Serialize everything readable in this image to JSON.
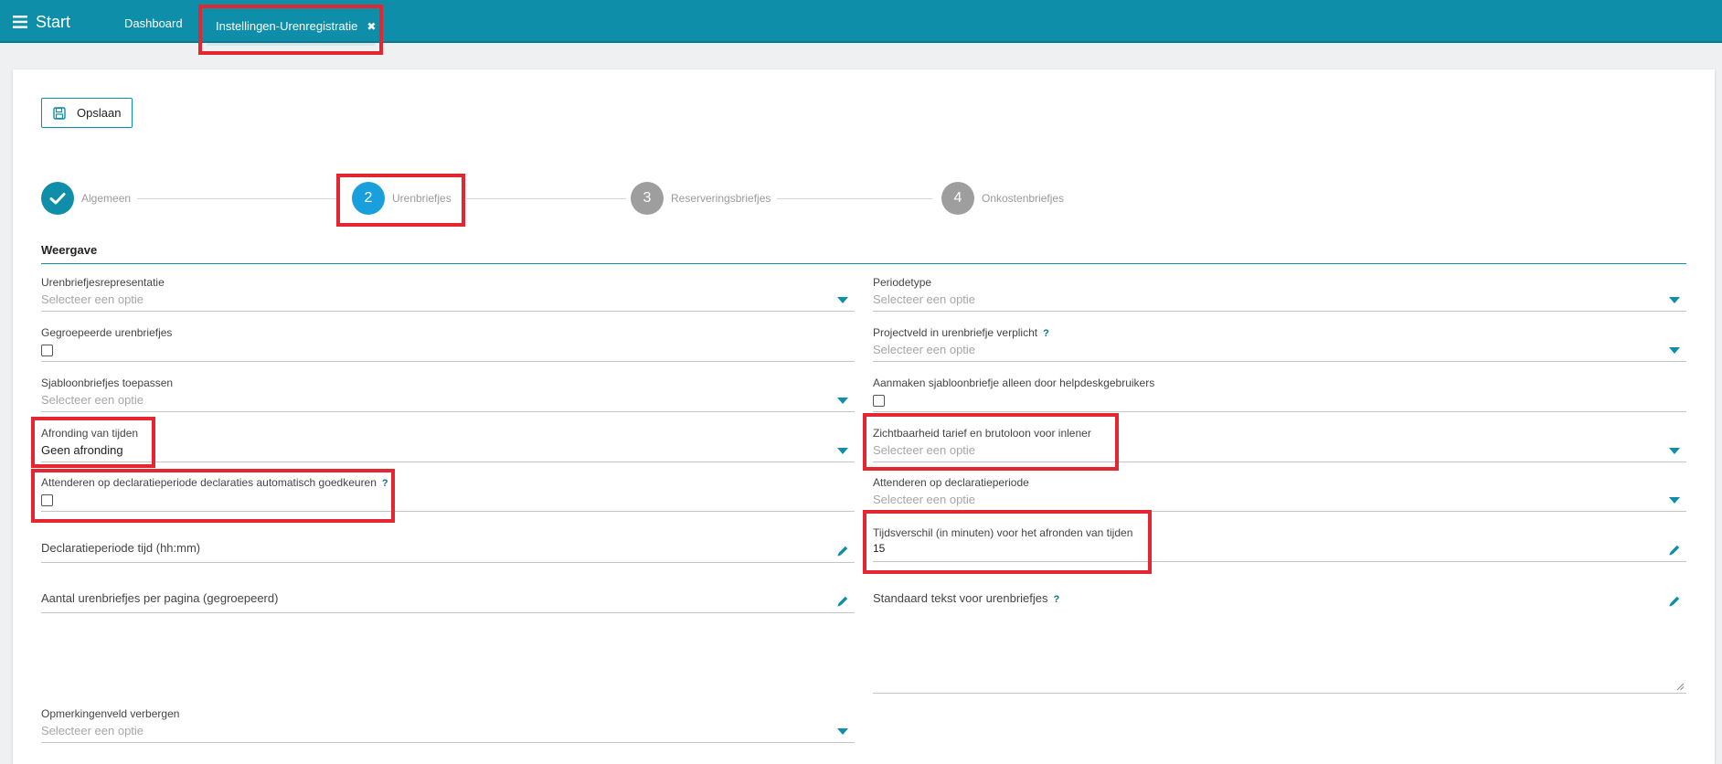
{
  "topbar": {
    "start_label": "Start",
    "tabs": [
      {
        "label": "Dashboard"
      },
      {
        "label": "Instellingen-Urenregistratie",
        "close": "✖"
      }
    ]
  },
  "toolbar": {
    "save_label": "Opslaan"
  },
  "stepper": [
    {
      "number": "",
      "label": "Algemeen",
      "state": "done",
      "color": "#0e8ea8"
    },
    {
      "number": "2",
      "label": "Urenbriefjes",
      "state": "active",
      "color": "#1a9fdd"
    },
    {
      "number": "3",
      "label": "Reserveringsbriefjes",
      "state": "inactive",
      "color": "#9e9e9e"
    },
    {
      "number": "4",
      "label": "Onkostenbriefjes",
      "state": "inactive",
      "color": "#9e9e9e"
    }
  ],
  "section": {
    "title": "Weergave"
  },
  "left_fields": {
    "urenbriefjesrepresentatie": {
      "label": "Urenbriefjesrepresentatie",
      "placeholder": "Selecteer een optie"
    },
    "gegroepeerde": {
      "label": "Gegroepeerde urenbriefjes"
    },
    "sjabloon": {
      "label": "Sjabloonbriefjes toepassen",
      "placeholder": "Selecteer een optie"
    },
    "afronding": {
      "label": "Afronding van tijden",
      "value": "Geen afronding"
    },
    "attenderen_auto": {
      "label": "Attenderen op declaratieperiode declaraties automatisch goedkeuren",
      "help": "?"
    },
    "declaratieperiode_tijd": {
      "label": "Declaratieperiode tijd (hh:mm)"
    },
    "aantal_per_pagina": {
      "label": "Aantal urenbriefjes per pagina (gegroepeerd)"
    },
    "opmerkingenveld": {
      "label": "Opmerkingenveld verbergen",
      "placeholder": "Selecteer een optie"
    }
  },
  "right_fields": {
    "periodetype": {
      "label": "Periodetype",
      "placeholder": "Selecteer een optie"
    },
    "projectveld": {
      "label": "Projectveld in urenbriefje verplicht",
      "help": "?",
      "placeholder": "Selecteer een optie"
    },
    "aanmaken_sjabloon": {
      "label": "Aanmaken sjabloonbriefje alleen door helpdeskgebruikers"
    },
    "zichtbaarheid": {
      "label": "Zichtbaarheid tarief en brutoloon voor inlener",
      "placeholder": "Selecteer een optie"
    },
    "attenderen": {
      "label": "Attenderen op declaratieperiode",
      "placeholder": "Selecteer een optie"
    },
    "tijdsverschil": {
      "label": "Tijdsverschil (in minuten) voor het afronden van tijden",
      "value": "15"
    },
    "standaard_tekst": {
      "label": "Standaard tekst voor urenbriefjes",
      "help": "?"
    }
  },
  "colors": {
    "brand": "#0e8ea8",
    "highlight": "#e3262f",
    "active_step": "#1a9fdd",
    "inactive_step": "#9e9e9e"
  }
}
